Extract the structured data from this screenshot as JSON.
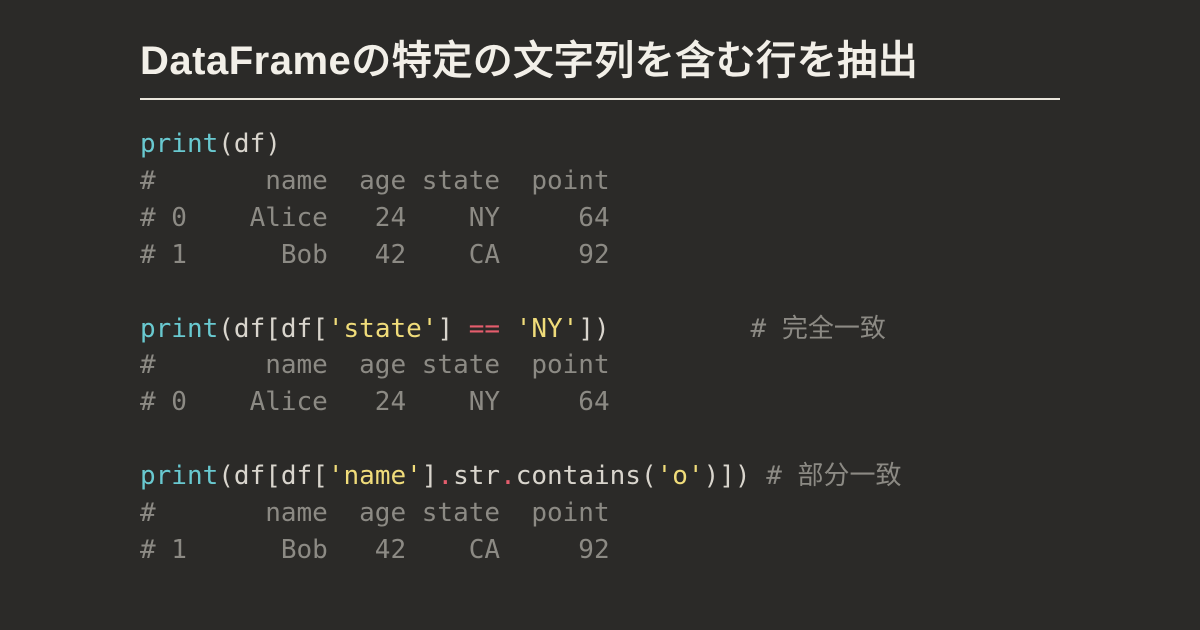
{
  "title": "DataFrameの特定の文字列を含む行を抽出",
  "code": {
    "block1": {
      "fn": "print",
      "open": "(df)",
      "out1": "#       name  age state  point",
      "out2": "# 0    Alice   24    NY     64",
      "out3": "# 1      Bob   42    CA     92"
    },
    "block2": {
      "fn": "print",
      "p1": "(df[df[",
      "s1": "'state'",
      "p2": "] ",
      "op": "==",
      "p3": " ",
      "s2": "'NY'",
      "p4": "])         ",
      "cmt": "# 完全一致",
      "out1": "#       name  age state  point",
      "out2": "# 0    Alice   24    NY     64"
    },
    "block3": {
      "fn": "print",
      "p1": "(df[df[",
      "s1": "'name'",
      "p2": "]",
      "dot1": ".",
      "m1": "str",
      "dot2": ".",
      "m2": "contains(",
      "s2": "'o'",
      "p3": ")]) ",
      "cmt": "# 部分一致",
      "out1": "#       name  age state  point",
      "out2": "# 1      Bob   42    CA     92"
    }
  }
}
